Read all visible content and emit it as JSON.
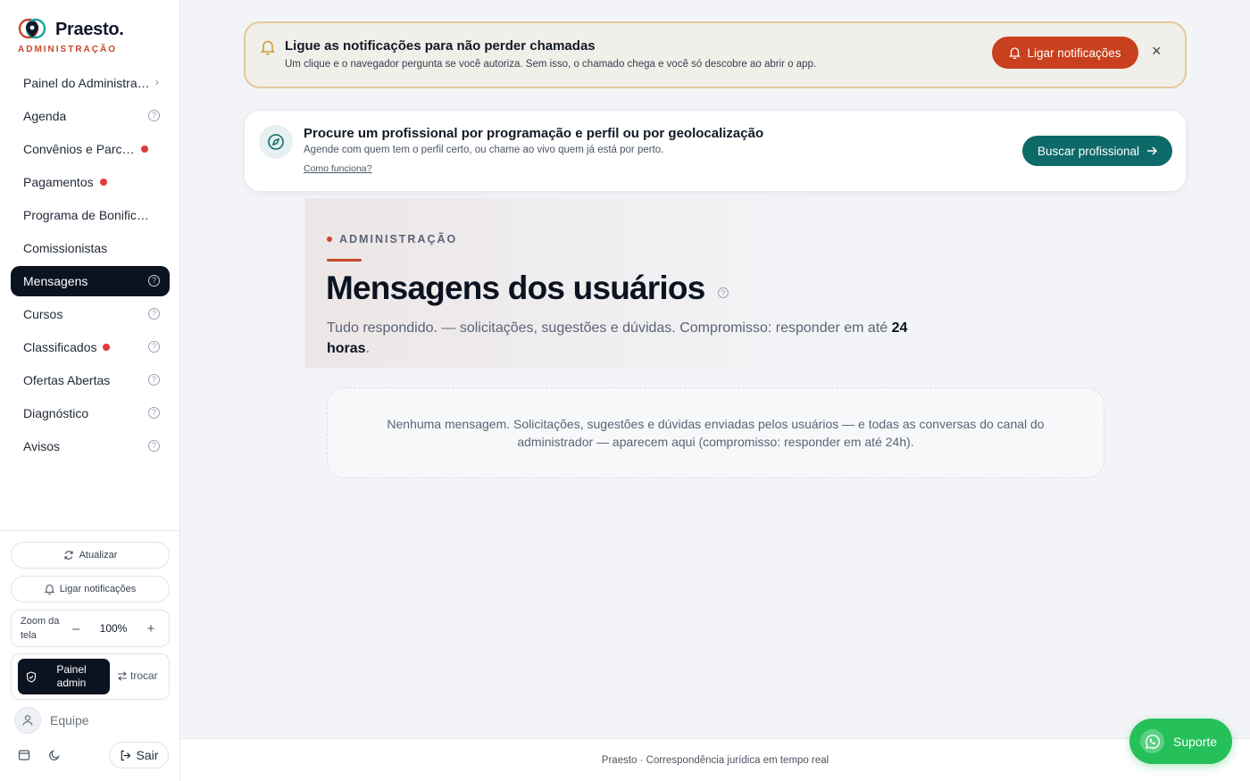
{
  "brand": {
    "name": "Praesto.",
    "sub": "ADMINISTRAÇÃO",
    "accent": "#c8472a"
  },
  "sidebar": {
    "items": [
      {
        "label": "Painel do Administra…",
        "badge": false,
        "help": false,
        "chevron": true,
        "active": false
      },
      {
        "label": "Agenda",
        "badge": false,
        "help": true,
        "active": false
      },
      {
        "label": "Convênios e Parc…",
        "badge": true,
        "help": false,
        "active": false
      },
      {
        "label": "Pagamentos",
        "badge": true,
        "help": false,
        "active": false
      },
      {
        "label": "Programa de Bonific…",
        "badge": false,
        "help": false,
        "active": false
      },
      {
        "label": "Comissionistas",
        "badge": false,
        "help": false,
        "active": false
      },
      {
        "label": "Mensagens",
        "badge": false,
        "help": true,
        "active": true
      },
      {
        "label": "Cursos",
        "badge": false,
        "help": true,
        "active": false
      },
      {
        "label": "Classificados",
        "badge": true,
        "help": true,
        "active": false
      },
      {
        "label": "Ofertas Abertas",
        "badge": false,
        "help": true,
        "active": false
      },
      {
        "label": "Diagnóstico",
        "badge": false,
        "help": true,
        "active": false
      },
      {
        "label": "Avisos",
        "badge": false,
        "help": true,
        "active": false
      }
    ],
    "refresh_label": "Atualizar",
    "notify_label": "Ligar notificações",
    "zoom": {
      "label": "Zoom da tela",
      "value": "100%",
      "minus": "–",
      "plus": "+"
    },
    "mode": {
      "active_label": "Painel admin",
      "switch_label": "trocar"
    },
    "team_label": "Equipe",
    "exit_label": "Sair"
  },
  "banner": {
    "title": "Ligue as notificações para não perder chamadas",
    "desc": "Um clique e o navegador pergunta se você autoriza. Sem isso, o chamado chega e você só descobre ao abrir o app.",
    "button": "Ligar notificações",
    "close": "×"
  },
  "search": {
    "title": "Procure um profissional por programação e perfil ou por geolocalização",
    "desc": "Agende com quem tem o perfil certo, ou chame ao vivo quem já está por perto.",
    "link": "Como funciona?",
    "button": "Buscar profissional"
  },
  "page": {
    "eyebrow": "ADMINISTRAÇÃO",
    "title": "Mensagens dos usuários",
    "subtitle_prefix": "Tudo respondido. — solicitações, sugestões e dúvidas. Compromisso: responder em até ",
    "subtitle_bold": "24 horas",
    "subtitle_suffix": ".",
    "empty": "Nenhuma mensagem. Solicitações, sugestões e dúvidas enviadas pelos usuários — e todas as conversas do canal do administrador — aparecem aqui (compromisso: responder em até 24h)."
  },
  "footer": {
    "text": "Praesto · Correspondência jurídica em tempo real"
  },
  "support": {
    "label": "Suporte"
  },
  "icons": {
    "nav_help": "help-icon",
    "nav_chevron": "chevron-right-icon",
    "banner_bell": "bell-icon",
    "search": "compass-icon",
    "support": "whatsapp-icon"
  }
}
